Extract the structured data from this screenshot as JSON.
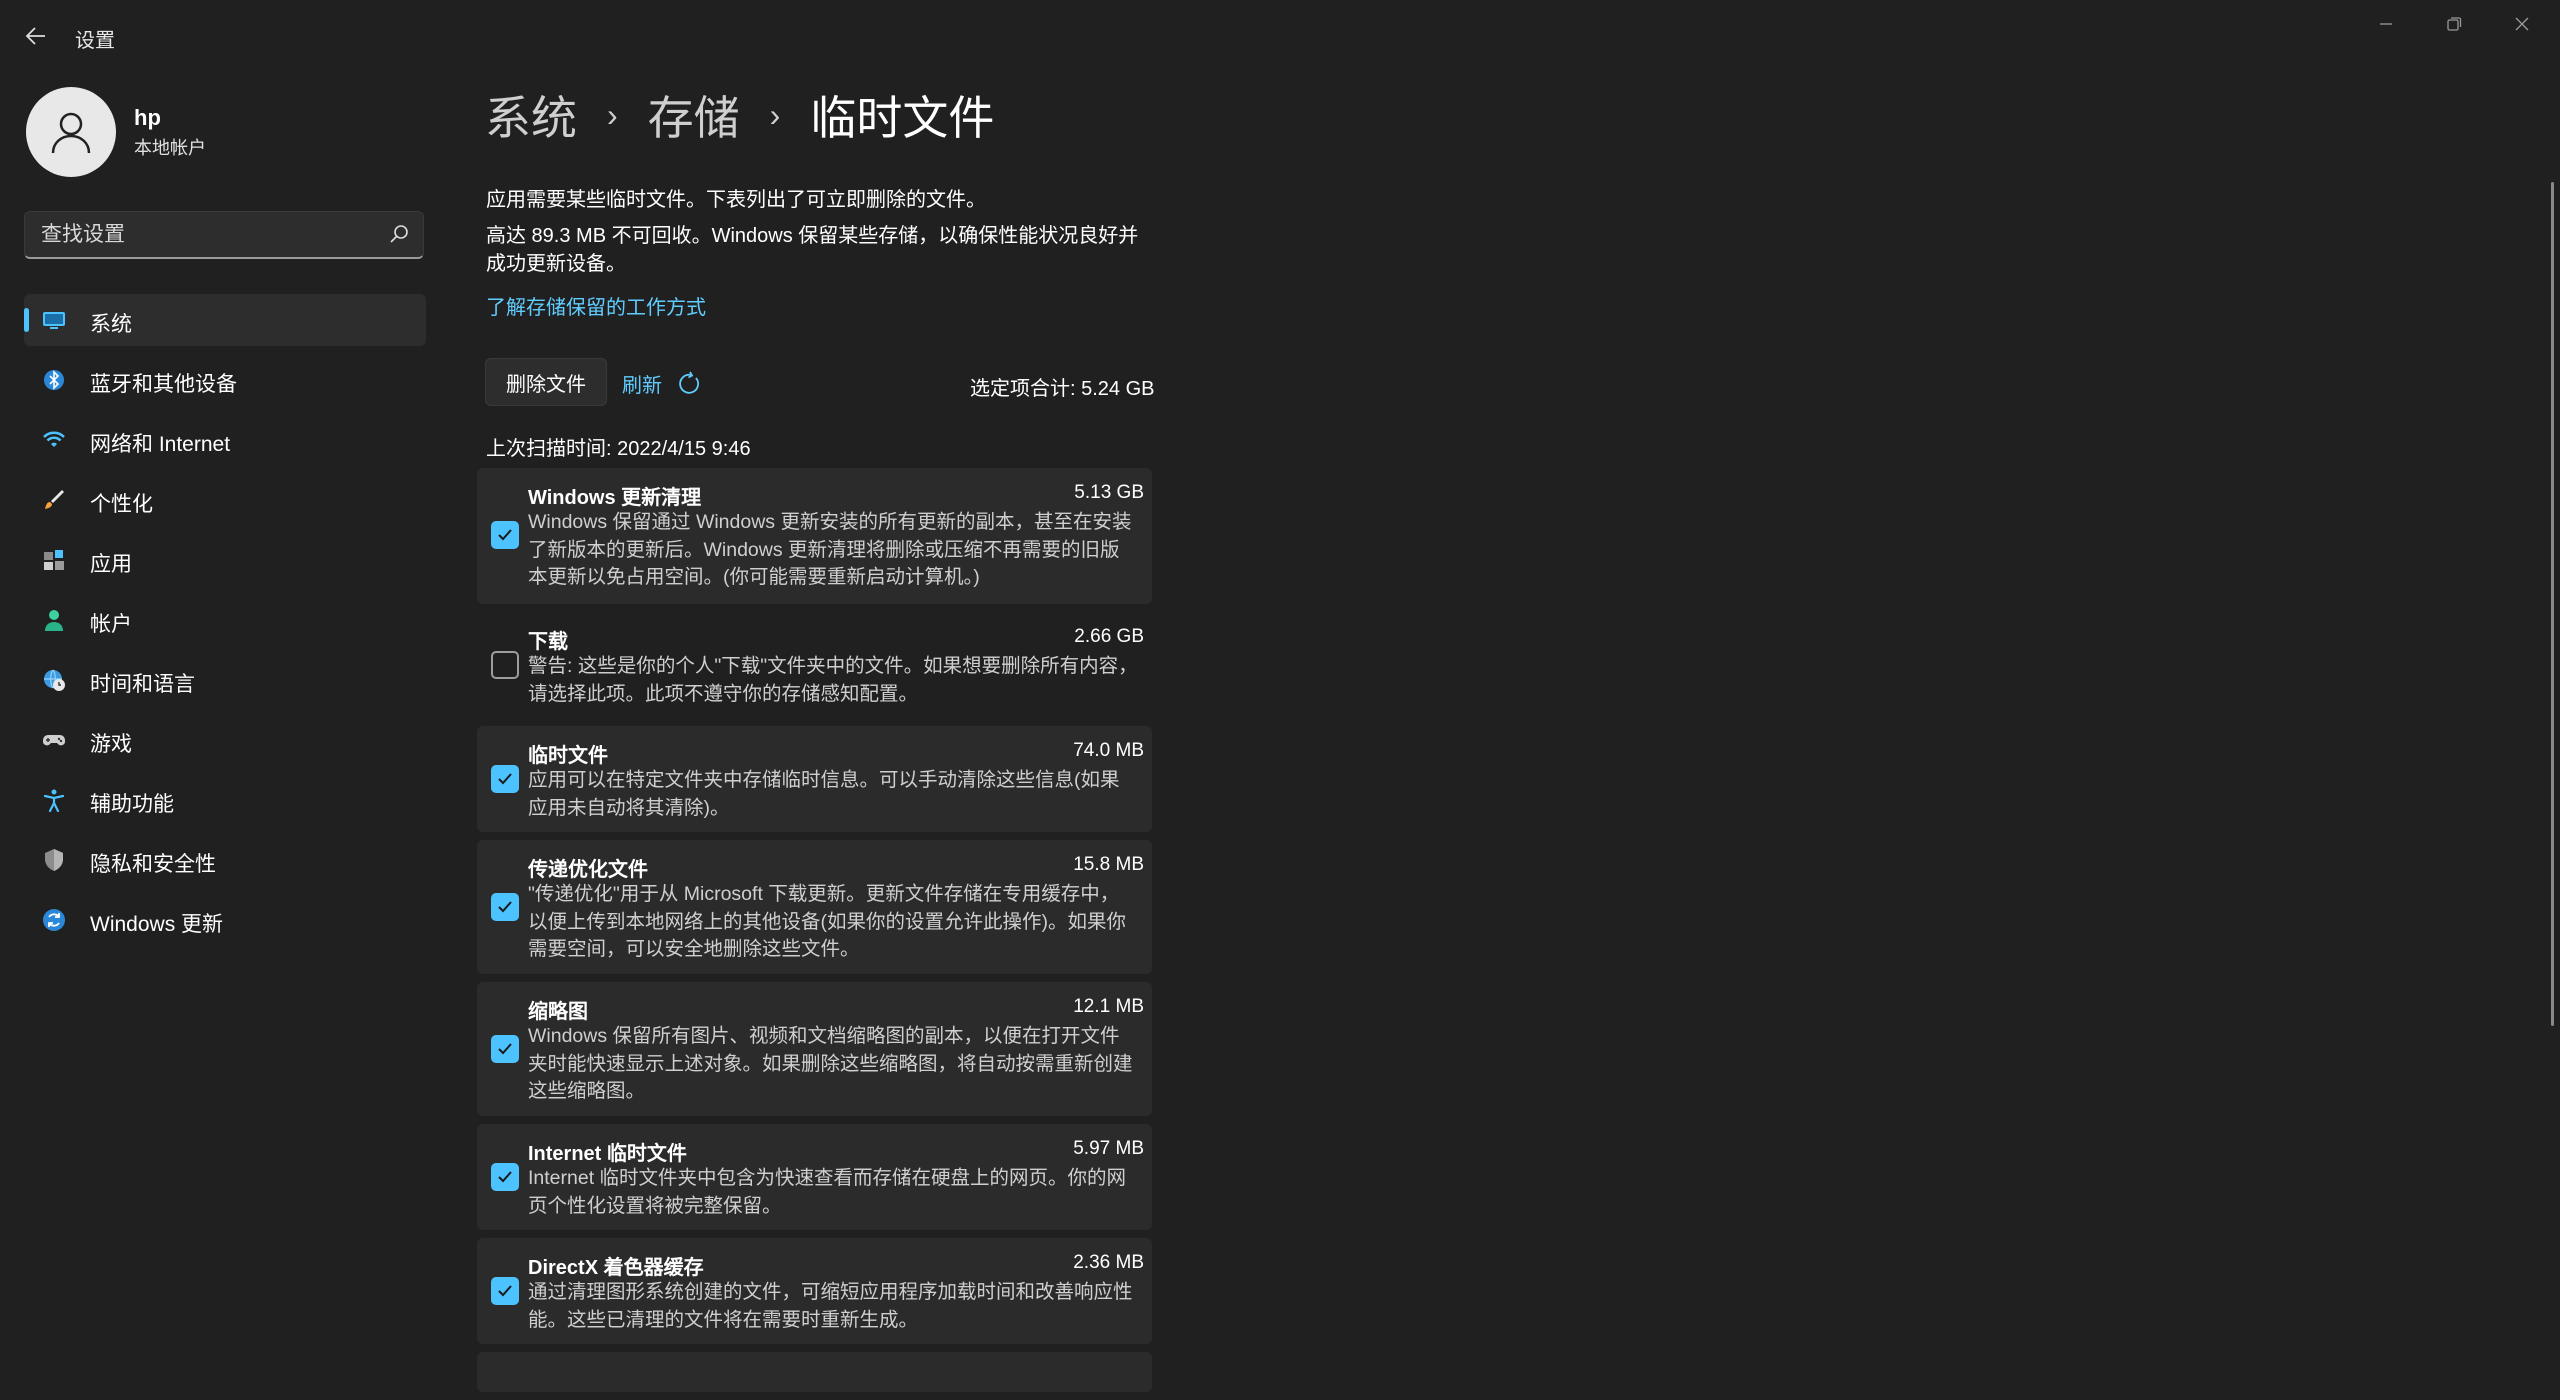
{
  "window": {
    "title": "设置"
  },
  "user": {
    "name": "hp",
    "account_type": "本地帐户"
  },
  "search": {
    "placeholder": "查找设置"
  },
  "sidebar": {
    "items": [
      {
        "label": "系统",
        "icon": "system-icon",
        "active": true
      },
      {
        "label": "蓝牙和其他设备",
        "icon": "bluetooth-icon"
      },
      {
        "label": "网络和 Internet",
        "icon": "wifi-icon"
      },
      {
        "label": "个性化",
        "icon": "brush-icon"
      },
      {
        "label": "应用",
        "icon": "apps-icon"
      },
      {
        "label": "帐户",
        "icon": "account-icon"
      },
      {
        "label": "时间和语言",
        "icon": "globe-clock-icon"
      },
      {
        "label": "游戏",
        "icon": "gamepad-icon"
      },
      {
        "label": "辅助功能",
        "icon": "accessibility-icon"
      },
      {
        "label": "隐私和安全性",
        "icon": "shield-icon"
      },
      {
        "label": "Windows 更新",
        "icon": "update-icon"
      }
    ]
  },
  "breadcrumb": {
    "items": [
      "系统",
      "存储",
      "临时文件"
    ]
  },
  "main": {
    "description1": "应用需要某些临时文件。下表列出了可立即删除的文件。",
    "description2": "高达 89.3 MB 不可回收。Windows 保留某些存储，以确保性能状况良好并成功更新设备。",
    "learn_link": "了解存储保留的工作方式",
    "delete_button": "删除文件",
    "refresh_button": "刷新",
    "selected_total": "选定项合计: 5.24 GB",
    "last_scan": "上次扫描时间: 2022/4/15 9:46"
  },
  "items": [
    {
      "title": "Windows 更新清理",
      "size": "5.13 GB",
      "checked": true,
      "description": "Windows 保留通过 Windows 更新安装的所有更新的副本，甚至在安装了新版本的更新后。Windows 更新清理将删除或压缩不再需要的旧版本更新以免占用空间。(你可能需要重新启动计算机。)"
    },
    {
      "title": "下载",
      "size": "2.66 GB",
      "checked": false,
      "description": "警告: 这些是你的个人\"下载\"文件夹中的文件。如果想要删除所有内容，请选择此项。此项不遵守你的存储感知配置。"
    },
    {
      "title": "临时文件",
      "size": "74.0 MB",
      "checked": true,
      "description": "应用可以在特定文件夹中存储临时信息。可以手动清除这些信息(如果应用未自动将其清除)。"
    },
    {
      "title": "传递优化文件",
      "size": "15.8 MB",
      "checked": true,
      "description": "\"传递优化\"用于从 Microsoft 下载更新。更新文件存储在专用缓存中，以便上传到本地网络上的其他设备(如果你的设置允许此操作)。如果你需要空间，可以安全地删除这些文件。"
    },
    {
      "title": "缩略图",
      "size": "12.1 MB",
      "checked": true,
      "description": "Windows 保留所有图片、视频和文档缩略图的副本，以便在打开文件夹时能快速显示上述对象。如果删除这些缩略图，将自动按需重新创建这些缩略图。"
    },
    {
      "title": "Internet 临时文件",
      "size": "5.97 MB",
      "checked": true,
      "description": "Internet 临时文件夹中包含为快速查看而存储在硬盘上的网页。你的网页个性化设置将被完整保留。"
    },
    {
      "title": "DirectX 着色器缓存",
      "size": "2.36 MB",
      "checked": true,
      "description": "通过清理图形系统创建的文件，可缩短应用程序加载时间和改善响应性能。这些已清理的文件将在需要时重新生成。"
    }
  ],
  "colors": {
    "background": "#202020",
    "accent": "#4cc2ff",
    "link": "#60cdff",
    "card": "#2b2b2b"
  }
}
